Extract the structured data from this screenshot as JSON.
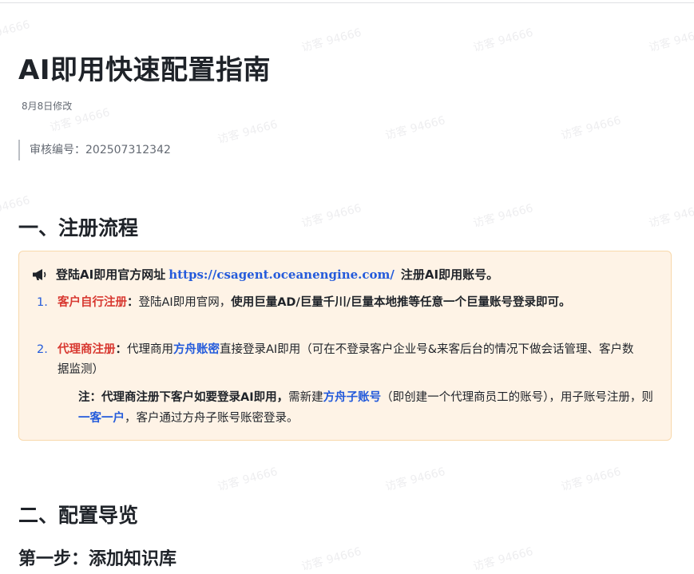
{
  "doc": {
    "title": "AI即用快速配置指南",
    "modified": "8月8日修改",
    "audit_number": "审核编号：202507312342"
  },
  "watermark": "访客 94666",
  "section1": {
    "heading": "一、注册流程",
    "callout": {
      "icon": "megaphone-icon",
      "lead": "登陆AI即用官方网址",
      "url": "https://csagent.oceanengine.com/",
      "tail": "注册AI即用账号。",
      "items": [
        {
          "number": "1.",
          "label": "客户自行注册",
          "colon": "：",
          "text1": "登陆AI即用官网，",
          "text2": "使用巨量AD/巨量千川/巨量本地推等任意一个巨量账号登录即可。"
        },
        {
          "number": "2.",
          "label": "代理商注册",
          "colon": "：",
          "text1": "代理商用",
          "link": "方舟账密",
          "text2": "直接登录AI即用（可在不登录客户企业号&来客后台的情况下做会话管理、客户数据监测）"
        }
      ],
      "note": {
        "bold": "注：代理商注册下客户如要登录AI即用，",
        "text1": "需新建",
        "link1": "方舟子账号",
        "text2": "（即创建一个代理商员工的账号），用子账号注册，则",
        "link2": "一客一户",
        "text3": "，客户通过方舟子账号账密登录。"
      }
    }
  },
  "section2": {
    "heading": "二、配置导览",
    "step1": "第一步：添加知识库"
  },
  "colors": {
    "link": "#245bdb",
    "red": "#d83931",
    "callout_bg": "#fef3e6",
    "callout_border": "#f8d9ac"
  }
}
